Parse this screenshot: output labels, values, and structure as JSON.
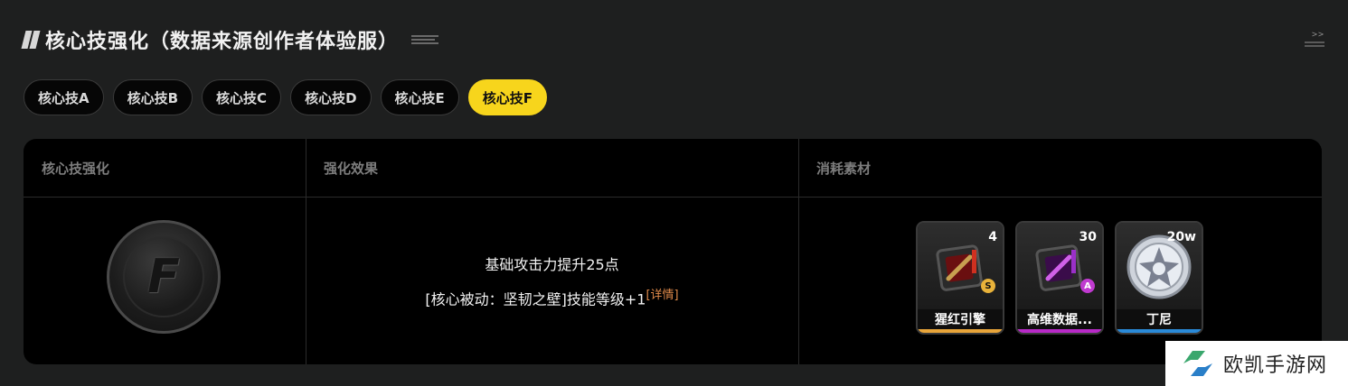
{
  "header": {
    "title": "核心技强化（数据来源创作者体验服）"
  },
  "tabs": [
    {
      "label": "核心技A",
      "active": false
    },
    {
      "label": "核心技B",
      "active": false
    },
    {
      "label": "核心技C",
      "active": false
    },
    {
      "label": "核心技D",
      "active": false
    },
    {
      "label": "核心技E",
      "active": false
    },
    {
      "label": "核心技F",
      "active": true
    }
  ],
  "table": {
    "headers": [
      "核心技强化",
      "强化效果",
      "消耗素材"
    ],
    "row": {
      "skill_icon_letter": "F",
      "effect_line1": "基础攻击力提升25点",
      "effect_line2": "[核心被动：坚韧之壁]技能等级+1",
      "detail_link": "[详情]",
      "materials": [
        {
          "name": "猩红引擎",
          "count": "4",
          "rank": "S",
          "rank_color": "#e8b23a",
          "bar_color": "#e8a53a",
          "icon": "engine-red-icon"
        },
        {
          "name": "高维数据...",
          "count": "30",
          "rank": "A",
          "rank_color": "#c03ad0",
          "bar_color": "#b82ac8",
          "icon": "data-purple-icon"
        },
        {
          "name": "丁尼",
          "count": "20w",
          "rank": "",
          "rank_color": "",
          "bar_color": "#2a8ad8",
          "icon": "coin-star-icon"
        }
      ]
    }
  },
  "watermark": {
    "text": "欧凯手游网"
  }
}
